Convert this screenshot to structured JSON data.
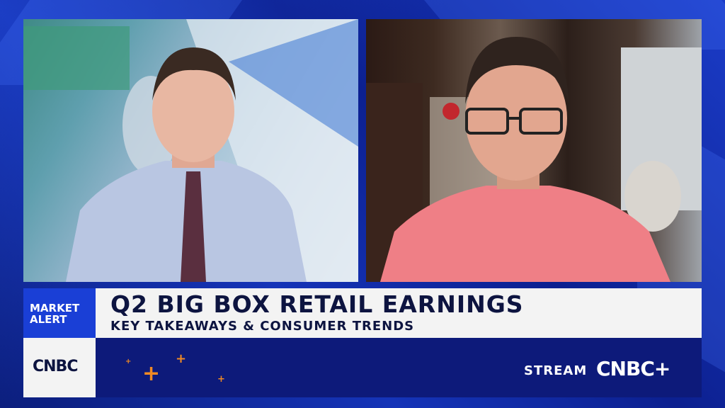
{
  "lower_third": {
    "alert_line1": "MARKET",
    "alert_line2": "ALERT",
    "headline": "Q2 BIG BOX RETAIL EARNINGS",
    "subheadline": "KEY TAKEAWAYS & CONSUMER TRENDS"
  },
  "branding": {
    "logo": "CNBC",
    "stream_label": "STREAM",
    "stream_brand": "CNBC+"
  },
  "colors": {
    "background": "#0a1a6e",
    "alert_blue": "#1a3fd6",
    "accent_orange": "#f08a24",
    "headline_text": "#0d1440"
  }
}
